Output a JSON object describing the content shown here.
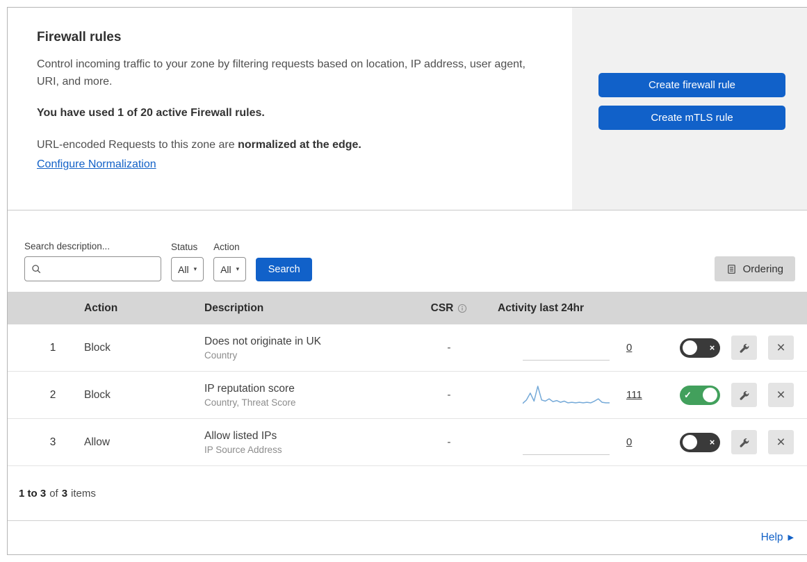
{
  "colors": {
    "accent_blue": "#1161c9",
    "link_blue": "#1261c7",
    "toggle_on_green": "#42a05c",
    "toggle_off_dark": "#3a3a3a",
    "header_gray": "#d6d6d6",
    "panel_gray": "#f1f1f1",
    "spark_blue": "#74a9d8"
  },
  "header": {
    "title": "Firewall rules",
    "description": "Control incoming traffic to your zone by filtering requests based on location, IP address, user agent, URI, and more.",
    "usage": "You have used 1 of 20 active Firewall rules.",
    "normalization_text": "URL-encoded Requests to this zone are",
    "normalization_bold": "normalized at the edge.",
    "normalization_link": "Configure Normalization",
    "create_firewall_button": "Create firewall rule",
    "create_mtls_button": "Create mTLS rule"
  },
  "filters": {
    "search_label": "Search description...",
    "status_label": "Status",
    "status_value": "All",
    "action_label": "Action",
    "action_value": "All",
    "search_button": "Search",
    "ordering_button": "Ordering"
  },
  "table": {
    "headers": {
      "action": "Action",
      "description": "Description",
      "csr": "CSR",
      "activity": "Activity last 24hr"
    },
    "rows": [
      {
        "priority": "1",
        "action": "Block",
        "description": "Does not originate in UK",
        "fields": "Country",
        "csr": "-",
        "activity_count": "0",
        "enabled": false
      },
      {
        "priority": "2",
        "action": "Block",
        "description": "IP reputation score",
        "fields": "Country, Threat Score",
        "csr": "-",
        "activity_count": "111",
        "enabled": true
      },
      {
        "priority": "3",
        "action": "Allow",
        "description": "Allow listed IPs",
        "fields": "IP Source Address",
        "csr": "-",
        "activity_count": "0",
        "enabled": false
      }
    ]
  },
  "footer": {
    "range": "1 to 3",
    "of": "of",
    "total": "3",
    "items": "items",
    "help": "Help"
  },
  "chart_data": {
    "type": "line",
    "title": "Activity last 24hr",
    "x_range_hours": 24,
    "line_color": "#74a9d8",
    "series": [
      {
        "name": "Rule 1 - Does not originate in UK",
        "total": 0,
        "values": [
          0,
          0,
          0,
          0,
          0,
          0,
          0,
          0,
          0,
          0,
          0,
          0,
          0,
          0,
          0,
          0,
          0,
          0,
          0,
          0,
          0,
          0,
          0,
          0
        ]
      },
      {
        "name": "Rule 2 - IP reputation score",
        "total": 111,
        "values": [
          4,
          10,
          22,
          8,
          34,
          10,
          8,
          12,
          7,
          9,
          6,
          8,
          5,
          6,
          5,
          6,
          5,
          6,
          5,
          8,
          12,
          6,
          5,
          5
        ]
      },
      {
        "name": "Rule 3 - Allow listed IPs",
        "total": 0,
        "values": [
          0,
          0,
          0,
          0,
          0,
          0,
          0,
          0,
          0,
          0,
          0,
          0,
          0,
          0,
          0,
          0,
          0,
          0,
          0,
          0,
          0,
          0,
          0,
          0
        ]
      }
    ]
  }
}
